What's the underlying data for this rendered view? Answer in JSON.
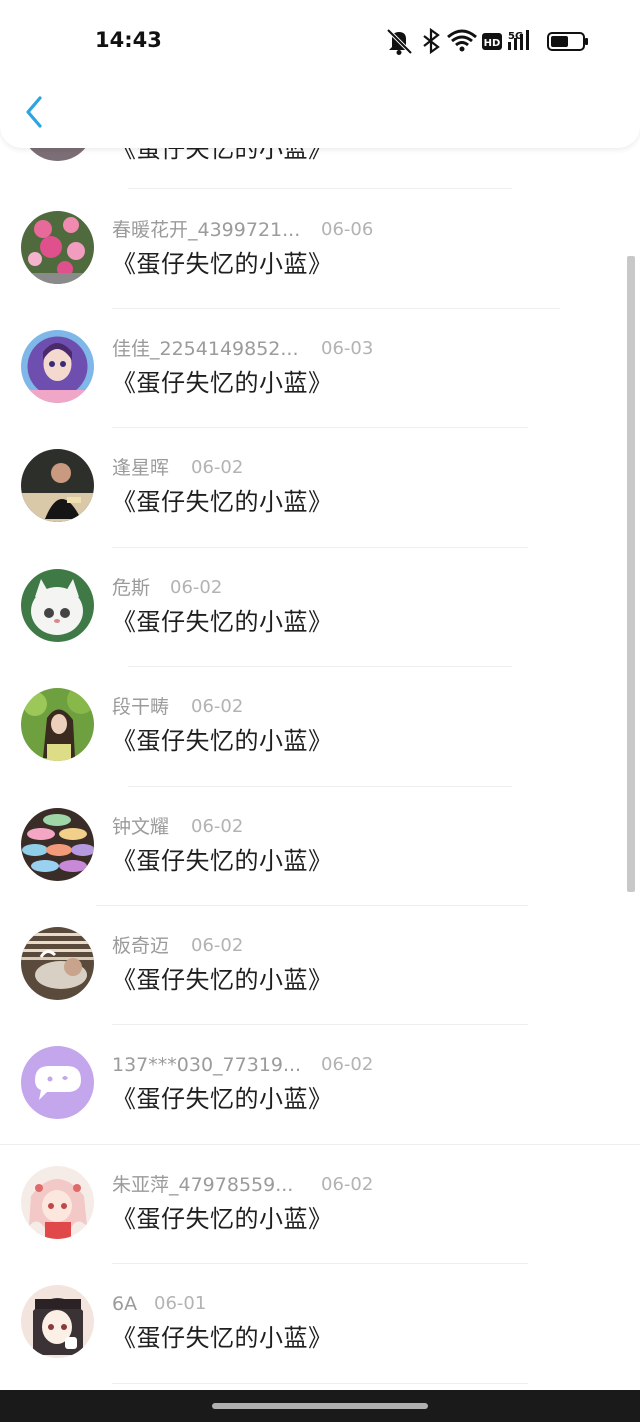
{
  "status_bar": {
    "time": "14:43",
    "icons": [
      "mute-bell-icon",
      "bluetooth-icon",
      "wifi-icon",
      "hd-icon",
      "5g-signal-icon",
      "battery-icon"
    ],
    "hd_text": "HD",
    "network_text": "5G"
  },
  "header": {
    "back_icon": "chevron-left-icon",
    "accent": "#2aa5e0"
  },
  "list": {
    "partial_top_title": "《蛋仔失忆的小蓝》",
    "items": [
      {
        "name": "春暖花开_4399721...",
        "date": "06-06",
        "title": "《蛋仔失忆的小蓝》",
        "avatar": "pink-flowers-photo"
      },
      {
        "name": "佳佳_2254149852...",
        "date": "06-03",
        "title": "《蛋仔失忆的小蓝》",
        "avatar": "anime-doll-photo"
      },
      {
        "name": "逢星晖",
        "date": "06-02",
        "title": "《蛋仔失忆的小蓝》",
        "avatar": "man-at-table-photo"
      },
      {
        "name": "危斯",
        "date": "06-02",
        "title": "《蛋仔失忆的小蓝》",
        "avatar": "white-cat-photo"
      },
      {
        "name": "段干畴",
        "date": "06-02",
        "title": "《蛋仔失忆的小蓝》",
        "avatar": "girl-in-greenery-photo"
      },
      {
        "name": "钟文耀",
        "date": "06-02",
        "title": "《蛋仔失忆的小蓝》",
        "avatar": "macarons-photo"
      },
      {
        "name": "板奇迈",
        "date": "06-02",
        "title": "《蛋仔失忆的小蓝》",
        "avatar": "man-with-blinds-photo"
      },
      {
        "name": "137***030_77319...",
        "date": "06-02",
        "title": "《蛋仔失忆的小蓝》",
        "avatar": "default-chat-bubble-avatar"
      },
      {
        "name": "朱亚萍_47978559...",
        "date": "06-02",
        "title": "《蛋仔失忆的小蓝》",
        "avatar": "anime-girl-drawing"
      },
      {
        "name": "6A",
        "date": "06-01",
        "title": "《蛋仔失忆的小蓝》",
        "avatar": "anime-girl-hat-drawing"
      }
    ]
  }
}
